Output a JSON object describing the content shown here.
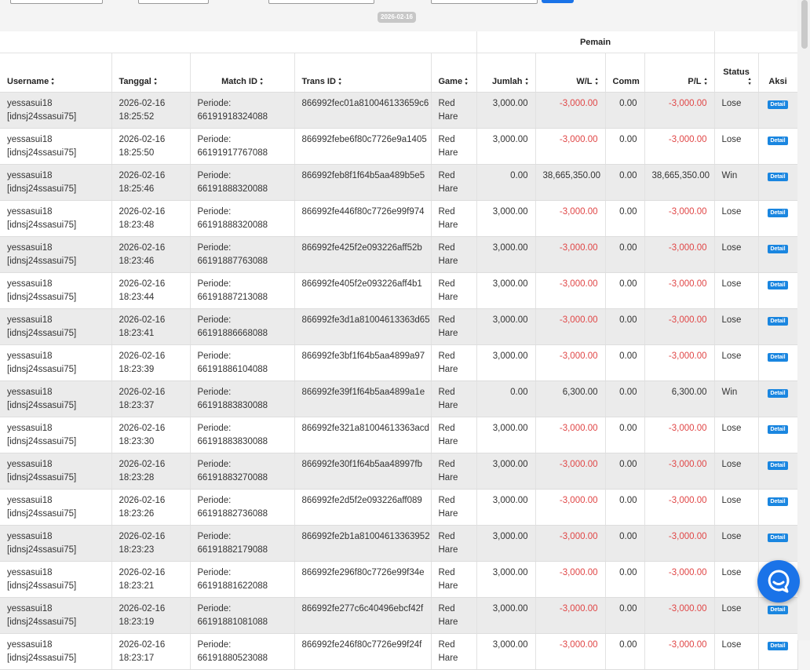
{
  "date_label": "2026-02-16",
  "header": {
    "group_label": "Pemain",
    "columns": [
      "Username",
      "Tanggal",
      "Match ID",
      "Trans ID",
      "Game",
      "Jumlah",
      "W/L",
      "Comm",
      "P/L",
      "Status",
      "Aksi"
    ]
  },
  "rows": [
    {
      "user": "yessasui18",
      "account": "[idnsj24ssasui75]",
      "date": "2026-02-16",
      "time": "18:25:52",
      "period_label": "Periode:",
      "period": "66191918324088",
      "trans": "866992fec01a810046133659c6",
      "game1": "Red",
      "game2": "Hare",
      "amount": "3,000.00",
      "wl": "-3,000.00",
      "comm": "0.00",
      "pl": "-3,000.00",
      "status": "Lose",
      "action": "Detail"
    },
    {
      "user": "yessasui18",
      "account": "[idnsj24ssasui75]",
      "date": "2026-02-16",
      "time": "18:25:50",
      "period_label": "Periode:",
      "period": "66191917767088",
      "trans": "866992febe6f80c7726e9a1405",
      "game1": "Red",
      "game2": "Hare",
      "amount": "3,000.00",
      "wl": "-3,000.00",
      "comm": "0.00",
      "pl": "-3,000.00",
      "status": "Lose",
      "action": "Detail"
    },
    {
      "user": "yessasui18",
      "account": "[idnsj24ssasui75]",
      "date": "2026-02-16",
      "time": "18:25:46",
      "period_label": "Periode:",
      "period": "66191888320088",
      "trans": "866992feb8f1f64b5aa489b5e5",
      "game1": "Red",
      "game2": "Hare",
      "amount": "0.00",
      "wl": "38,665,350.00",
      "comm": "0.00",
      "pl": "38,665,350.00",
      "status": "Win",
      "action": "Detail"
    },
    {
      "user": "yessasui18",
      "account": "[idnsj24ssasui75]",
      "date": "2026-02-16",
      "time": "18:23:48",
      "period_label": "Periode:",
      "period": "66191888320088",
      "trans": "866992fe446f80c7726e99f974",
      "game1": "Red",
      "game2": "Hare",
      "amount": "3,000.00",
      "wl": "-3,000.00",
      "comm": "0.00",
      "pl": "-3,000.00",
      "status": "Lose",
      "action": "Detail"
    },
    {
      "user": "yessasui18",
      "account": "[idnsj24ssasui75]",
      "date": "2026-02-16",
      "time": "18:23:46",
      "period_label": "Periode:",
      "period": "66191887763088",
      "trans": "866992fe425f2e093226aff52b",
      "game1": "Red",
      "game2": "Hare",
      "amount": "3,000.00",
      "wl": "-3,000.00",
      "comm": "0.00",
      "pl": "-3,000.00",
      "status": "Lose",
      "action": "Detail"
    },
    {
      "user": "yessasui18",
      "account": "[idnsj24ssasui75]",
      "date": "2026-02-16",
      "time": "18:23:44",
      "period_label": "Periode:",
      "period": "66191887213088",
      "trans": "866992fe405f2e093226aff4b1",
      "game1": "Red",
      "game2": "Hare",
      "amount": "3,000.00",
      "wl": "-3,000.00",
      "comm": "0.00",
      "pl": "-3,000.00",
      "status": "Lose",
      "action": "Detail"
    },
    {
      "user": "yessasui18",
      "account": "[idnsj24ssasui75]",
      "date": "2026-02-16",
      "time": "18:23:41",
      "period_label": "Periode:",
      "period": "66191886668088",
      "trans": "866992fe3d1a81004613363d65",
      "game1": "Red",
      "game2": "Hare",
      "amount": "3,000.00",
      "wl": "-3,000.00",
      "comm": "0.00",
      "pl": "-3,000.00",
      "status": "Lose",
      "action": "Detail"
    },
    {
      "user": "yessasui18",
      "account": "[idnsj24ssasui75]",
      "date": "2026-02-16",
      "time": "18:23:39",
      "period_label": "Periode:",
      "period": "66191886104088",
      "trans": "866992fe3bf1f64b5aa4899a97",
      "game1": "Red",
      "game2": "Hare",
      "amount": "3,000.00",
      "wl": "-3,000.00",
      "comm": "0.00",
      "pl": "-3,000.00",
      "status": "Lose",
      "action": "Detail"
    },
    {
      "user": "yessasui18",
      "account": "[idnsj24ssasui75]",
      "date": "2026-02-16",
      "time": "18:23:37",
      "period_label": "Periode:",
      "period": "66191883830088",
      "trans": "866992fe39f1f64b5aa4899a1e",
      "game1": "Red",
      "game2": "Hare",
      "amount": "0.00",
      "wl": "6,300.00",
      "comm": "0.00",
      "pl": "6,300.00",
      "status": "Win",
      "action": "Detail"
    },
    {
      "user": "yessasui18",
      "account": "[idnsj24ssasui75]",
      "date": "2026-02-16",
      "time": "18:23:30",
      "period_label": "Periode:",
      "period": "66191883830088",
      "trans": "866992fe321a81004613363acd",
      "game1": "Red",
      "game2": "Hare",
      "amount": "3,000.00",
      "wl": "-3,000.00",
      "comm": "0.00",
      "pl": "-3,000.00",
      "status": "Lose",
      "action": "Detail"
    },
    {
      "user": "yessasui18",
      "account": "[idnsj24ssasui75]",
      "date": "2026-02-16",
      "time": "18:23:28",
      "period_label": "Periode:",
      "period": "66191883270088",
      "trans": "866992fe30f1f64b5aa48997fb",
      "game1": "Red",
      "game2": "Hare",
      "amount": "3,000.00",
      "wl": "-3,000.00",
      "comm": "0.00",
      "pl": "-3,000.00",
      "status": "Lose",
      "action": "Detail"
    },
    {
      "user": "yessasui18",
      "account": "[idnsj24ssasui75]",
      "date": "2026-02-16",
      "time": "18:23:26",
      "period_label": "Periode:",
      "period": "66191882736088",
      "trans": "866992fe2d5f2e093226aff089",
      "game1": "Red",
      "game2": "Hare",
      "amount": "3,000.00",
      "wl": "-3,000.00",
      "comm": "0.00",
      "pl": "-3,000.00",
      "status": "Lose",
      "action": "Detail"
    },
    {
      "user": "yessasui18",
      "account": "[idnsj24ssasui75]",
      "date": "2026-02-16",
      "time": "18:23:23",
      "period_label": "Periode:",
      "period": "66191882179088",
      "trans": "866992fe2b1a81004613363952",
      "game1": "Red",
      "game2": "Hare",
      "amount": "3,000.00",
      "wl": "-3,000.00",
      "comm": "0.00",
      "pl": "-3,000.00",
      "status": "Lose",
      "action": "Detail"
    },
    {
      "user": "yessasui18",
      "account": "[idnsj24ssasui75]",
      "date": "2026-02-16",
      "time": "18:23:21",
      "period_label": "Periode:",
      "period": "66191881622088",
      "trans": "866992fe296f80c7726e99f34e",
      "game1": "Red",
      "game2": "Hare",
      "amount": "3,000.00",
      "wl": "-3,000.00",
      "comm": "0.00",
      "pl": "-3,000.00",
      "status": "Lose",
      "action": "Detail"
    },
    {
      "user": "yessasui18",
      "account": "[idnsj24ssasui75]",
      "date": "2026-02-16",
      "time": "18:23:19",
      "period_label": "Periode:",
      "period": "66191881081088",
      "trans": "866992fe277c6c40496ebcf42f",
      "game1": "Red",
      "game2": "Hare",
      "amount": "3,000.00",
      "wl": "-3,000.00",
      "comm": "0.00",
      "pl": "-3,000.00",
      "status": "Lose",
      "action": "Detail"
    },
    {
      "user": "yessasui18",
      "account": "[idnsj24ssasui75]",
      "date": "2026-02-16",
      "time": "18:23:17",
      "period_label": "Periode:",
      "period": "66191880523088",
      "trans": "866992fe246f80c7726e99f24f",
      "game1": "Red",
      "game2": "Hare",
      "amount": "3,000.00",
      "wl": "-3,000.00",
      "comm": "0.00",
      "pl": "-3,000.00",
      "status": "Lose",
      "action": "Detail"
    }
  ],
  "colors": {
    "negative": "#e04646",
    "primary": "#1a73e8",
    "row_alt": "#ebebeb"
  },
  "icons": {
    "sort": "sort-icon",
    "chat": "chat-icon"
  }
}
